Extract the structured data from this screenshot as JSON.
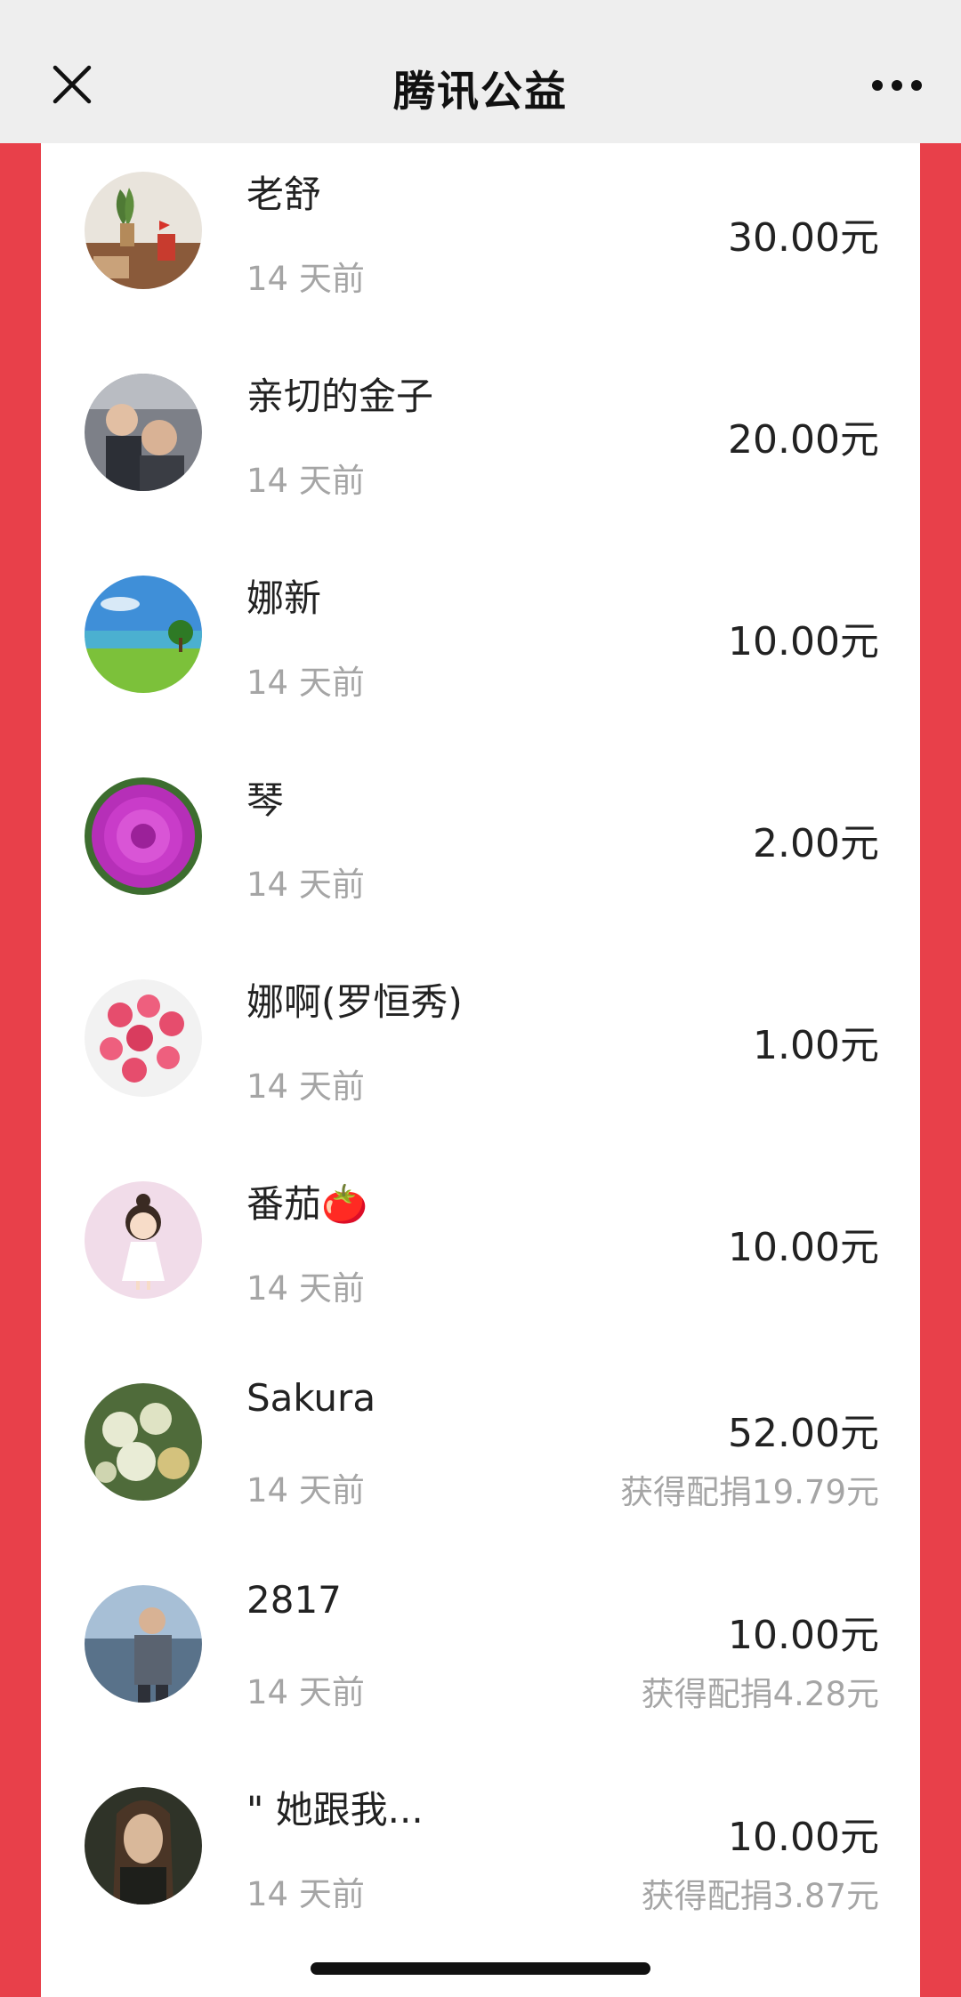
{
  "header": {
    "title": "腾讯公益",
    "close_icon": "close-icon",
    "more_icon": "more-dots-icon"
  },
  "colors": {
    "background_red": "#e8404a",
    "header_gray": "#eeeeee",
    "secondary_text": "#a5a5a5"
  },
  "donations": [
    {
      "name": "老舒",
      "time": "14 天前",
      "amount": "30.00元",
      "match": ""
    },
    {
      "name": "亲切的金子",
      "time": "14 天前",
      "amount": "20.00元",
      "match": ""
    },
    {
      "name": "娜新",
      "time": "14 天前",
      "amount": "10.00元",
      "match": ""
    },
    {
      "name": "琴",
      "time": "14 天前",
      "amount": "2.00元",
      "match": ""
    },
    {
      "name": "娜啊(罗恒秀)",
      "time": "14 天前",
      "amount": "1.00元",
      "match": ""
    },
    {
      "name": "番茄🍅",
      "time": "14 天前",
      "amount": "10.00元",
      "match": ""
    },
    {
      "name": "Sakura",
      "time": "14 天前",
      "amount": "52.00元",
      "match": "获得配捐19.79元"
    },
    {
      "name": "2817",
      "time": "14 天前",
      "amount": "10.00元",
      "match": "获得配捐4.28元"
    },
    {
      "name": "\" 她跟我...",
      "time": "14 天前",
      "amount": "10.00元",
      "match": "获得配捐3.87元"
    }
  ]
}
